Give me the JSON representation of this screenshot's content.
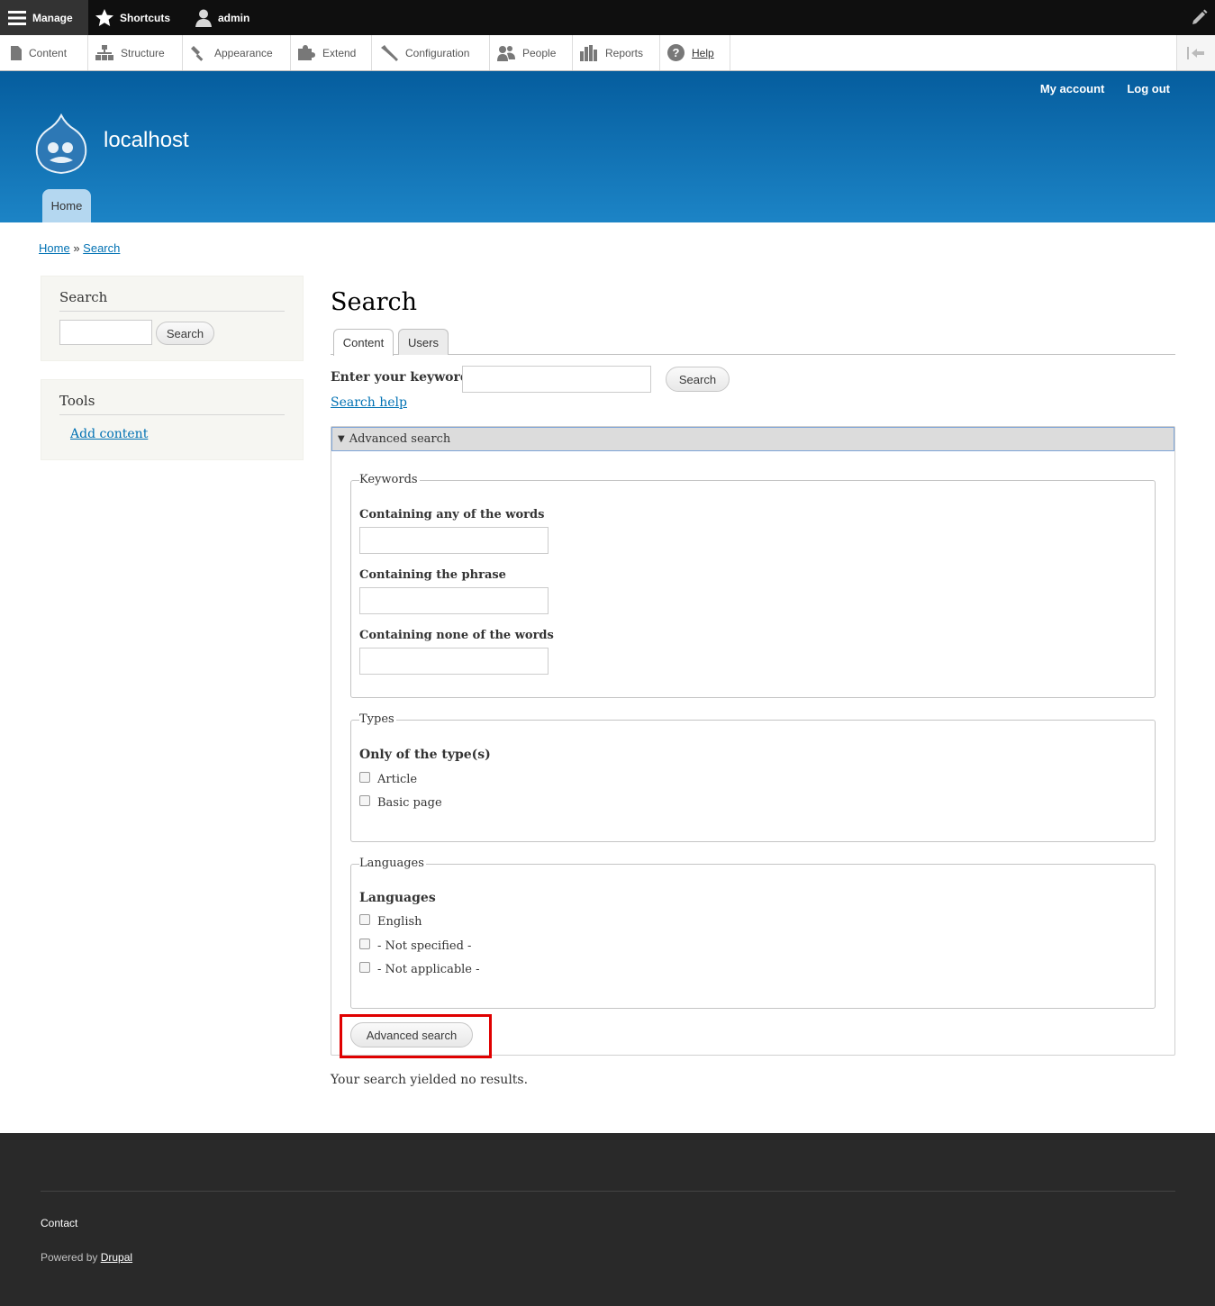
{
  "toolbar": {
    "manage": "Manage",
    "shortcuts": "Shortcuts",
    "user": "admin"
  },
  "tray": {
    "content": "Content",
    "structure": "Structure",
    "appearance": "Appearance",
    "extend": "Extend",
    "configuration": "Configuration",
    "people": "People",
    "reports": "Reports",
    "help": "Help"
  },
  "header": {
    "my_account": "My account",
    "log_out": "Log out",
    "site_name": "localhost",
    "home_tab": "Home"
  },
  "breadcrumb": {
    "home": "Home",
    "separator": "»",
    "current": "Search"
  },
  "sidebar": {
    "search_title": "Search",
    "search_button": "Search",
    "tools_title": "Tools",
    "add_content": "Add content"
  },
  "main": {
    "title": "Search",
    "tabs": [
      "Content",
      "Users"
    ],
    "keywords_label": "Enter your keywords:",
    "search_button": "Search",
    "search_help": "Search help",
    "advanced_legend": "Advanced search",
    "keywords_set": {
      "legend": "Keywords",
      "any_label": "Containing any of the words",
      "phrase_label": "Containing the phrase",
      "none_label": "Containing none of the words"
    },
    "types_set": {
      "legend": "Types",
      "group_label": "Only of the type(s)",
      "options": [
        "Article",
        "Basic page"
      ]
    },
    "languages_set": {
      "legend": "Languages",
      "group_label": "Languages",
      "options": [
        "English",
        "- Not specified -",
        "- Not applicable -"
      ]
    },
    "advanced_button": "Advanced search",
    "no_results": "Your search yielded no results."
  },
  "footer": {
    "contact": "Contact",
    "powered_by": "Powered by",
    "drupal": "Drupal"
  },
  "colors": {
    "header_top": "#055d9e",
    "header_bottom": "#1c84c6",
    "link": "#0071b3",
    "highlight": "#e00000",
    "footer_bg": "#292929"
  }
}
